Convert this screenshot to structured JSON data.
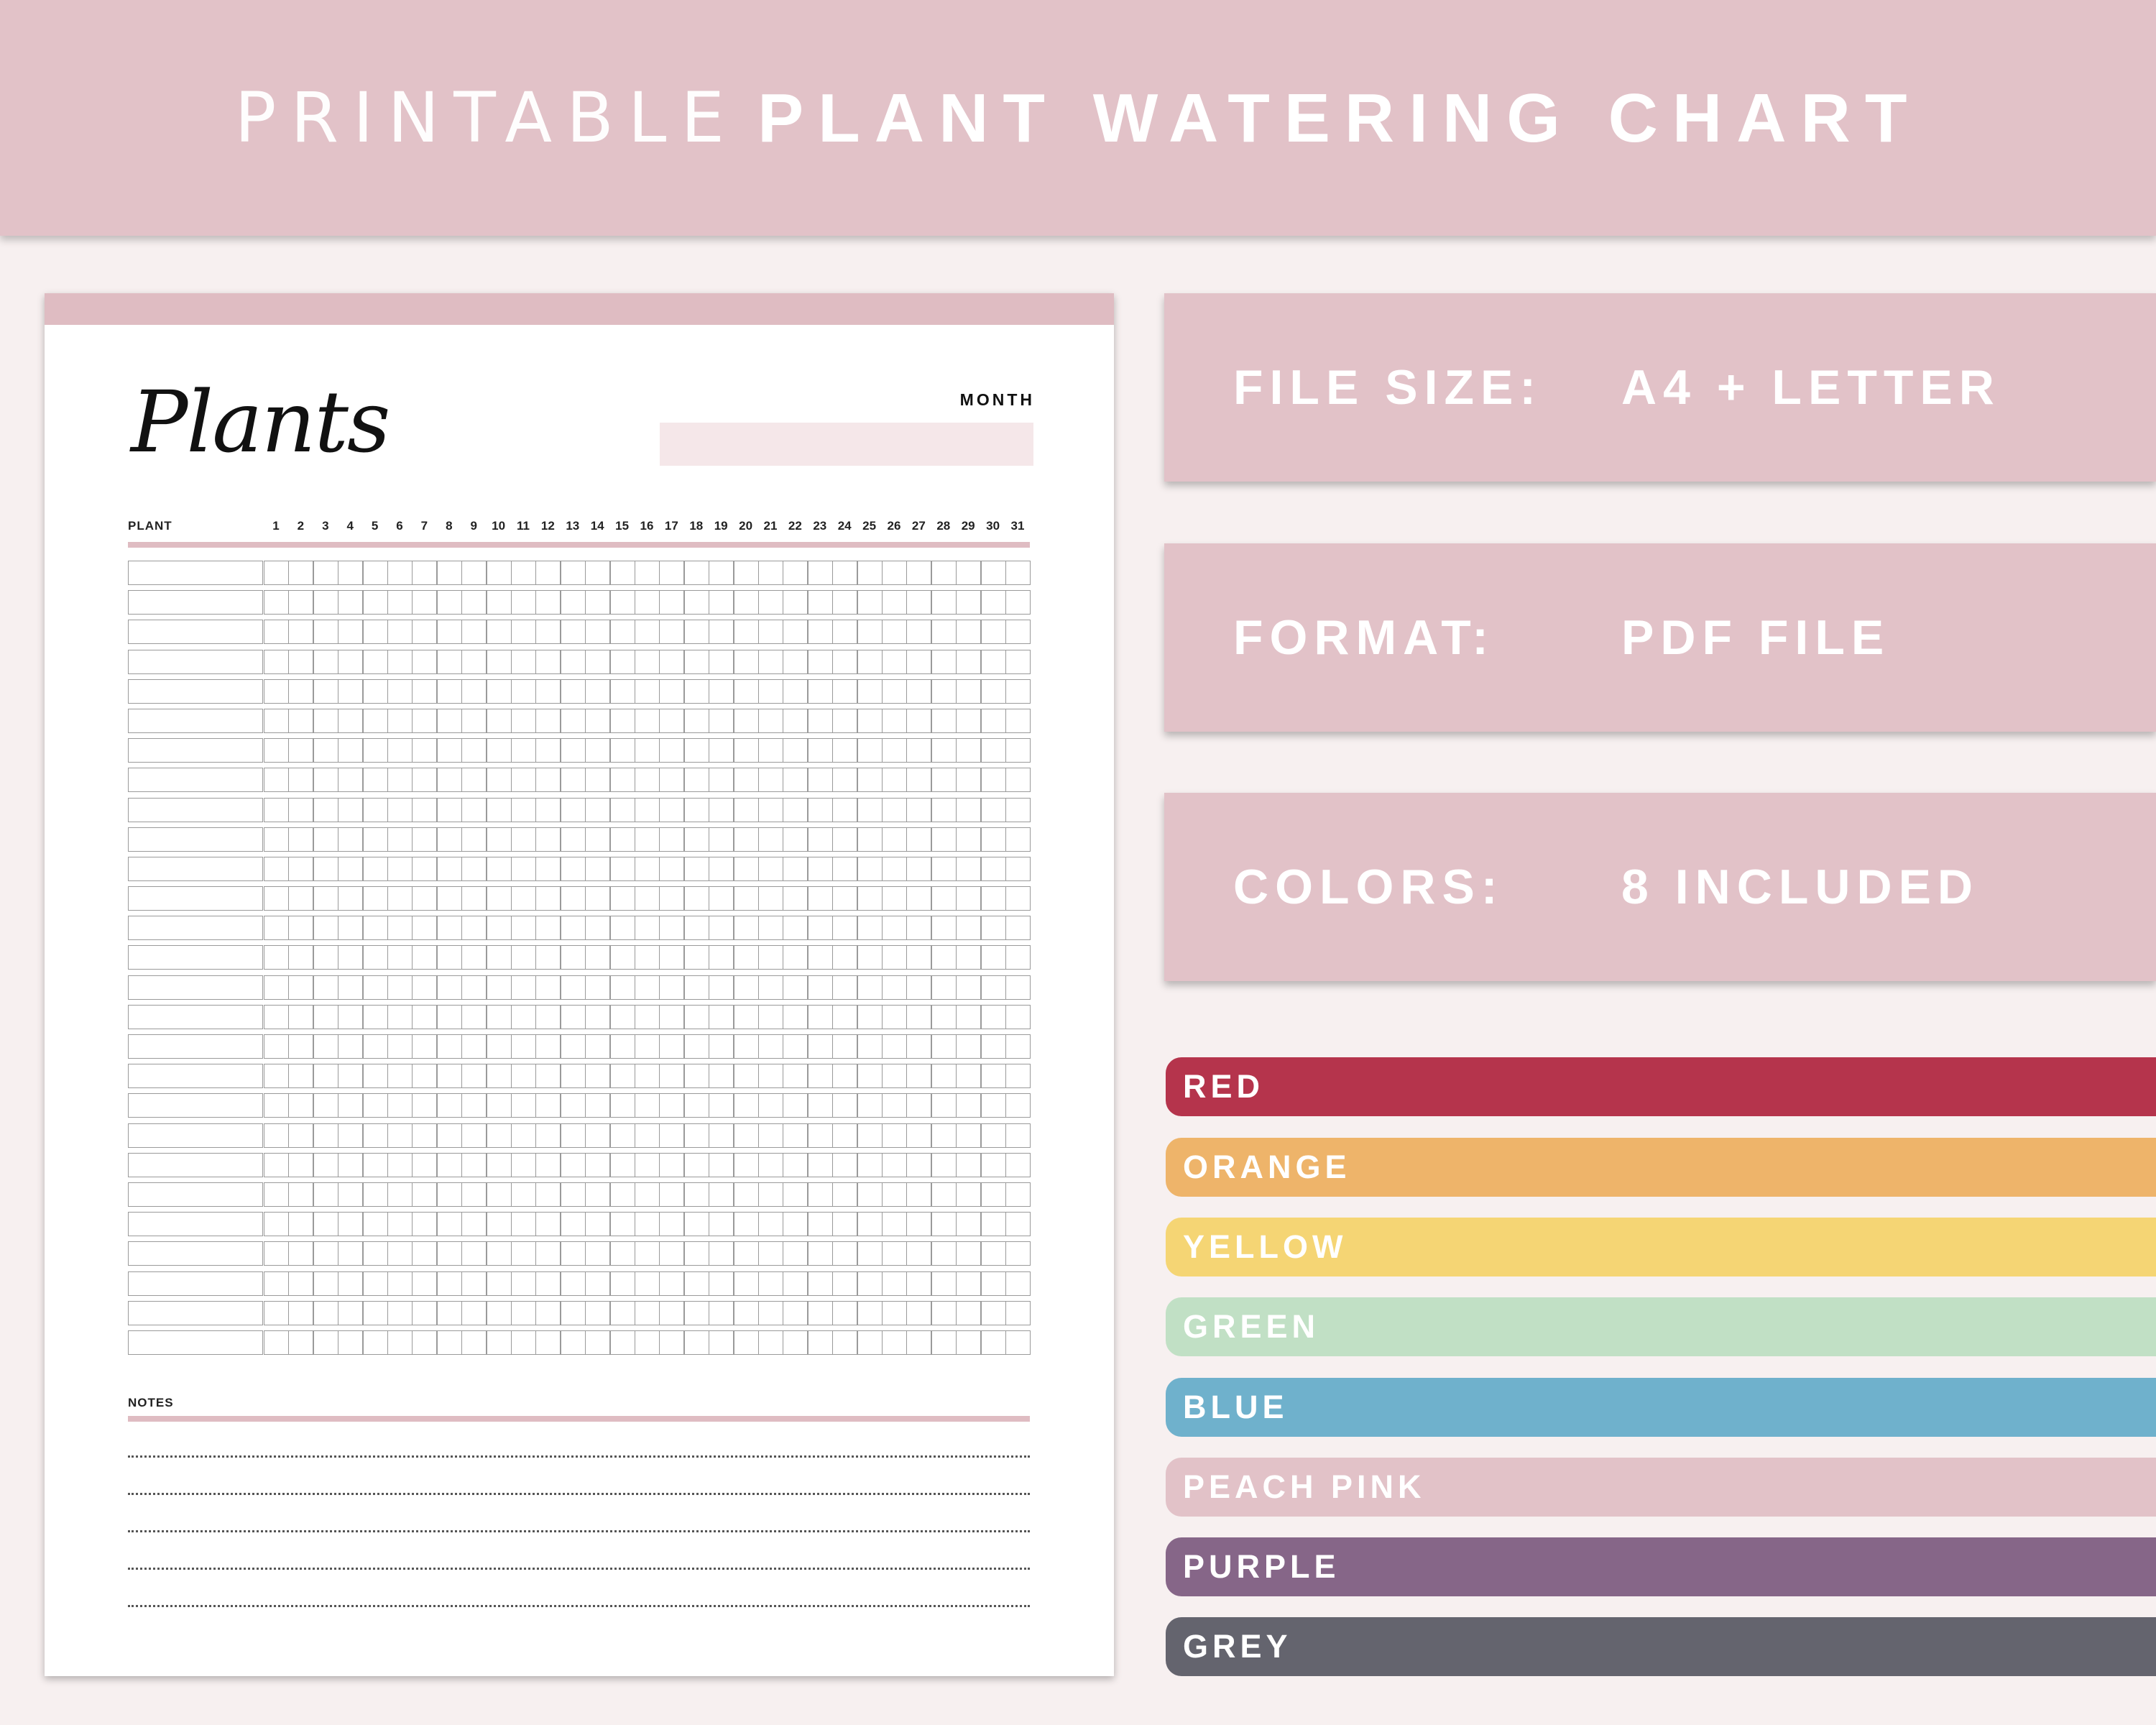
{
  "banner": {
    "title_light": "PRINTABLE",
    "title_bold": "PLANT WATERING CHART",
    "background": "#e2c2c8"
  },
  "sheet": {
    "heading": "Plants",
    "month_label": "MONTH",
    "plant_column_label": "PLANT",
    "days": [
      "1",
      "2",
      "3",
      "4",
      "5",
      "6",
      "7",
      "8",
      "9",
      "10",
      "11",
      "12",
      "13",
      "14",
      "15",
      "16",
      "17",
      "18",
      "19",
      "20",
      "21",
      "22",
      "23",
      "24",
      "25",
      "26",
      "27",
      "28",
      "29",
      "30",
      "31"
    ],
    "row_count": 27,
    "notes_label": "NOTES",
    "note_line_count": 5,
    "accent": "#dfbcc2"
  },
  "specs": [
    {
      "label": "FILE SIZE:",
      "value": "A4 + LETTER"
    },
    {
      "label": "FORMAT:",
      "value": "PDF FILE"
    },
    {
      "label": "COLORS:",
      "value": "8 INCLUDED"
    }
  ],
  "colors": [
    {
      "name": "RED",
      "hex": "#b5344c"
    },
    {
      "name": "ORANGE",
      "hex": "#eeb46a"
    },
    {
      "name": "YELLOW",
      "hex": "#f5d574"
    },
    {
      "name": "GREEN",
      "hex": "#c1e0c5"
    },
    {
      "name": "BLUE",
      "hex": "#6fb1cc"
    },
    {
      "name": "PEACH PINK",
      "hex": "#e2c2c8"
    },
    {
      "name": "PURPLE",
      "hex": "#866688"
    },
    {
      "name": "GREY",
      "hex": "#64646e"
    }
  ]
}
